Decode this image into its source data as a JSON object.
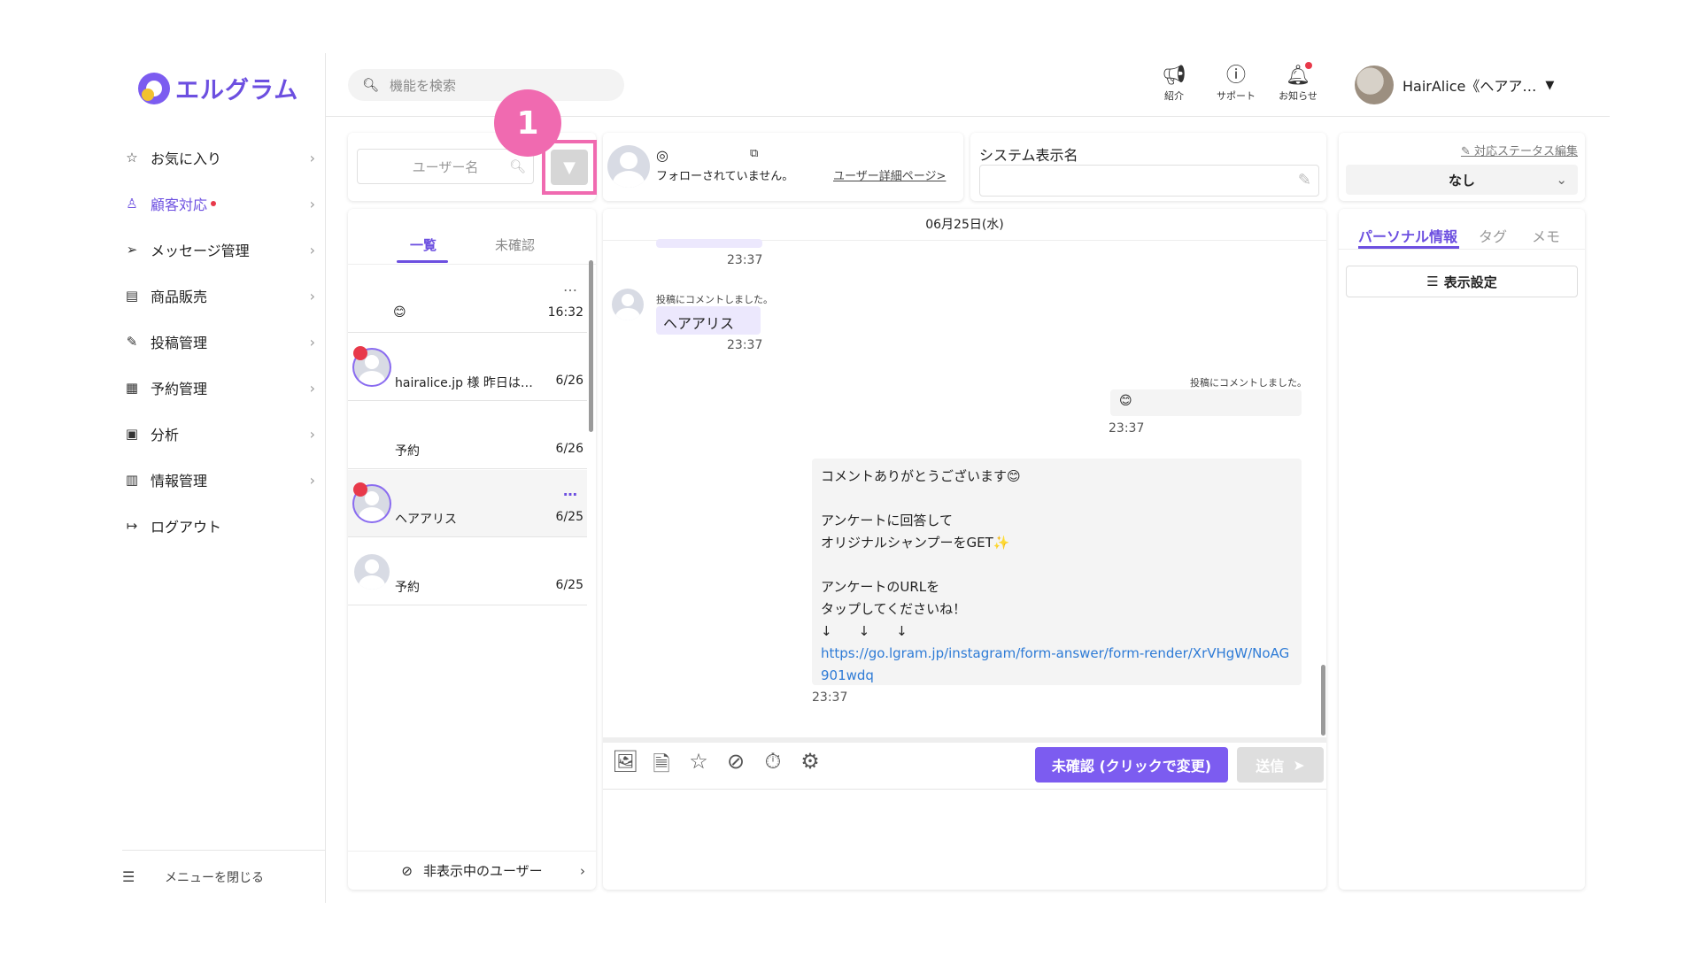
{
  "brand": {
    "name": "エルグラム"
  },
  "search": {
    "placeholder": "機能を検索"
  },
  "sidebar": {
    "items": [
      {
        "label": "お気に入り",
        "icon": "star-icon"
      },
      {
        "label": "顧客対応",
        "icon": "user-icon",
        "active": true
      },
      {
        "label": "メッセージ管理",
        "icon": "send-icon"
      },
      {
        "label": "商品販売",
        "icon": "shop-icon"
      },
      {
        "label": "投稿管理",
        "icon": "edit-icon"
      },
      {
        "label": "予約管理",
        "icon": "calendar-icon"
      },
      {
        "label": "分析",
        "icon": "report-icon"
      },
      {
        "label": "情報管理",
        "icon": "chart-icon"
      },
      {
        "label": "ログアウト",
        "icon": "logout-icon"
      }
    ],
    "close_label": "メニューを閉じる"
  },
  "header": {
    "intro": "紹介",
    "support": "サポート",
    "notice": "お知らせ",
    "account": "HairAlice《ヘアア…"
  },
  "user_search": {
    "placeholder": "ユーザー名"
  },
  "step_badge": "1",
  "profile": {
    "follow_status": "フォローされていません。",
    "detail_link": "ユーザー詳細ページ>"
  },
  "system_name": {
    "label": "システム表示名",
    "value": ""
  },
  "status": {
    "edit_label": "対応ステータス編集",
    "selected": "なし"
  },
  "list": {
    "tabs": [
      "一覧",
      "未確認"
    ],
    "rows": [
      {
        "text": "😊",
        "time": "16:32"
      },
      {
        "text": "hairalice.jp 様 昨日は…",
        "time": "6/26"
      },
      {
        "text": "予約",
        "time": "6/26"
      },
      {
        "text": "ヘアアリス",
        "time": "6/25"
      },
      {
        "text": "予約",
        "time": "6/25"
      }
    ],
    "hidden_users": "非表示中のユーザー"
  },
  "chat": {
    "date": "06月25日(水)",
    "messages": [
      {
        "time": "23:37"
      },
      {
        "note": "投稿にコメントしました。",
        "text": "ヘアアリス",
        "time": "23:37"
      },
      {
        "note": "投稿にコメントしました。",
        "text": "😊",
        "time": "23:37"
      }
    ],
    "long_message": {
      "lines": [
        "コメントありがとうございます😊",
        "",
        "アンケートに回答して",
        "オリジナルシャンプーをGET✨",
        "",
        "アンケートのURLを",
        "タップしてくださいね！",
        "↓　　↓　　↓"
      ],
      "link": "https://go.lgram.jp/instagram/form-answer/form-render/XrVHgW/NoAG901wdq",
      "time": "23:37"
    },
    "unconfirmed_button": "未確認 (クリックで変更)",
    "send_button": "送信"
  },
  "info": {
    "tabs": [
      "パーソナル情報",
      "タグ",
      "メモ"
    ],
    "display_settings": "表示設定"
  },
  "colors": {
    "accent": "#7c5cf0",
    "highlight": "#f06ab0",
    "alert": "#e8394a"
  }
}
